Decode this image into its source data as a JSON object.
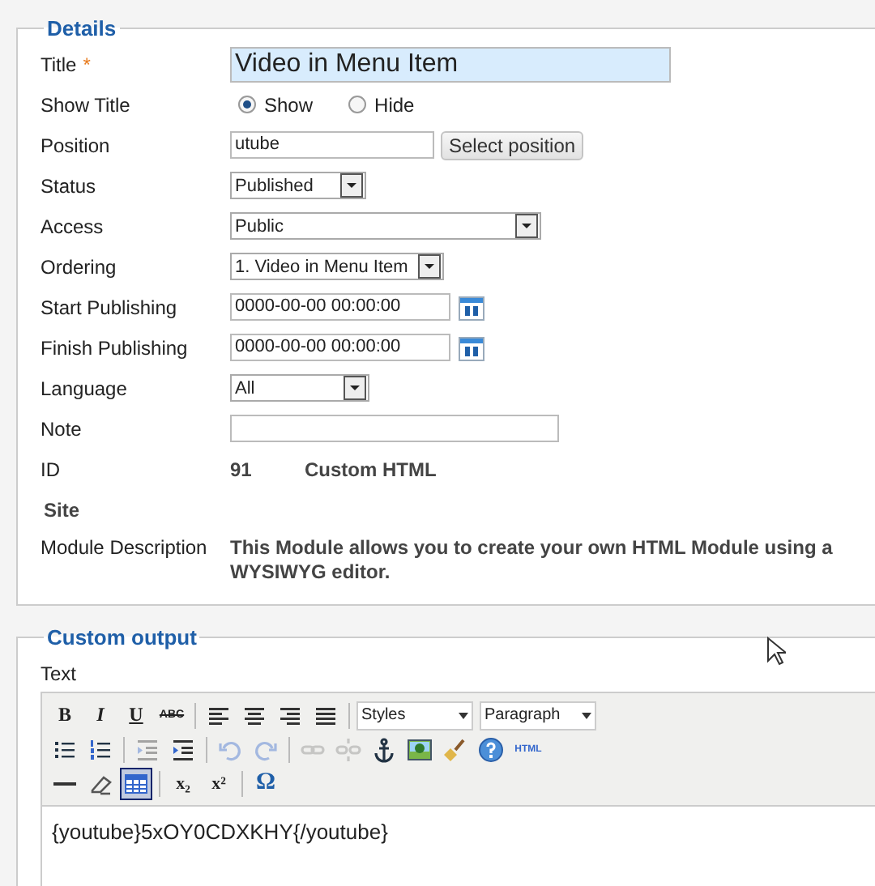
{
  "details": {
    "legend": "Details",
    "fields": [
      {
        "kind": "text",
        "label": "Title",
        "required_mark": "*",
        "focused": true,
        "value": "Video in Menu Item"
      },
      {
        "kind": "radio",
        "label": "Show Title",
        "options": [
          {
            "label": "Show",
            "selected": true
          },
          {
            "label": "Hide",
            "selected": false
          }
        ]
      },
      {
        "kind": "position",
        "label": "Position",
        "value": "utube",
        "button": "Select position"
      },
      {
        "kind": "select",
        "label": "Status",
        "value": "Published"
      },
      {
        "kind": "select",
        "label": "Access",
        "value": "Public"
      },
      {
        "kind": "select",
        "label": "Ordering",
        "value": "1. Video in Menu Item"
      },
      {
        "kind": "date",
        "label": "Start Publishing",
        "value": "0000-00-00 00:00:00"
      },
      {
        "kind": "date",
        "label": "Finish Publishing",
        "value": "0000-00-00 00:00:00"
      },
      {
        "kind": "select",
        "label": "Language",
        "value": "All"
      },
      {
        "kind": "text",
        "label": "Note",
        "focused": false
      },
      {
        "kind": "id",
        "label": "ID",
        "value": "91",
        "type_name": "Custom HTML"
      },
      {
        "kind": "heading",
        "label": "Site"
      },
      {
        "kind": "description",
        "label": "Module Description",
        "value": "This Module allows you to create your own HTML Module using a WYSIWYG editor."
      }
    ]
  },
  "custom_output": {
    "legend": "Custom output",
    "label": "Text",
    "toolbar_rows": [
      [
        {
          "kind": "text",
          "label": "B",
          "active": false,
          "disabled": false
        },
        {
          "kind": "text",
          "label": "I",
          "active": false,
          "disabled": false
        },
        {
          "kind": "text",
          "label": "U",
          "active": false,
          "disabled": false
        },
        {
          "kind": "text",
          "label": "ABC",
          "active": false,
          "disabled": false
        },
        {
          "kind": "separator"
        },
        {
          "kind": "icon",
          "active": false,
          "disabled": false
        },
        {
          "kind": "icon",
          "active": false,
          "disabled": false
        },
        {
          "kind": "icon",
          "active": false,
          "disabled": false
        },
        {
          "kind": "icon",
          "active": false,
          "disabled": false
        },
        {
          "kind": "separator"
        },
        {
          "kind": "select",
          "value": "Styles"
        },
        {
          "kind": "select",
          "value": "Paragraph"
        }
      ],
      [
        {
          "kind": "icon",
          "active": false,
          "disabled": false
        },
        {
          "kind": "icon",
          "active": false,
          "disabled": false
        },
        {
          "kind": "separator"
        },
        {
          "kind": "icon",
          "active": false,
          "disabled": true
        },
        {
          "kind": "icon",
          "active": false,
          "disabled": false
        },
        {
          "kind": "separator"
        },
        {
          "kind": "icon",
          "active": false,
          "disabled": true
        },
        {
          "kind": "icon",
          "active": false,
          "disabled": true
        },
        {
          "kind": "separator"
        },
        {
          "kind": "icon",
          "active": false,
          "disabled": true
        },
        {
          "kind": "icon",
          "active": false,
          "disabled": true
        },
        {
          "kind": "icon",
          "active": false,
          "disabled": false
        },
        {
          "kind": "icon",
          "active": false,
          "disabled": false
        },
        {
          "kind": "icon",
          "active": false,
          "disabled": false
        },
        {
          "kind": "icon",
          "active": false,
          "disabled": false
        },
        {
          "kind": "text",
          "label": "HTML",
          "active": false,
          "disabled": false
        }
      ],
      [
        {
          "kind": "icon",
          "active": false,
          "disabled": false
        },
        {
          "kind": "icon",
          "active": false,
          "disabled": false
        },
        {
          "kind": "icon",
          "active": true,
          "disabled": false
        },
        {
          "kind": "separator"
        },
        {
          "kind": "text",
          "label": "x₂",
          "active": false,
          "disabled": false
        },
        {
          "kind": "text",
          "label": "x²",
          "active": false,
          "disabled": false
        },
        {
          "kind": "separator"
        },
        {
          "kind": "text",
          "label": "Ω",
          "active": false,
          "disabled": false
        }
      ]
    ],
    "content": "{youtube}5xOY0CDXKHY{/youtube}"
  }
}
